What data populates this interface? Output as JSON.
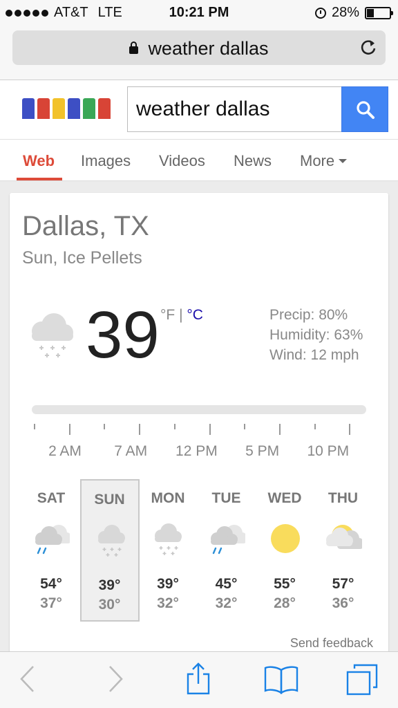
{
  "status_bar": {
    "carrier": "AT&T",
    "network": "LTE",
    "time": "10:21 PM",
    "battery_percent": "28%",
    "battery_level": 0.28,
    "signal_bars": 5
  },
  "browser": {
    "url_text": "weather dallas"
  },
  "search": {
    "query": "weather dallas",
    "logo_colors": [
      "#3d4fc4",
      "#d84436",
      "#f2c22a",
      "#3d4fc4",
      "#3aa757",
      "#d84436"
    ]
  },
  "tabs": [
    {
      "label": "Web",
      "active": true
    },
    {
      "label": "Images",
      "active": false
    },
    {
      "label": "Videos",
      "active": false
    },
    {
      "label": "News",
      "active": false
    },
    {
      "label": "More",
      "active": false
    }
  ],
  "weather": {
    "location": "Dallas, TX",
    "condition": "Sun, Ice Pellets",
    "temperature": "39",
    "unit_f": "°F",
    "unit_sep": " | ",
    "unit_c": "°C",
    "precip": "Precip: 80%",
    "humidity": "Humidity: 63%",
    "wind": "Wind: 12 mph",
    "hour_labels": [
      "2 AM",
      "7 AM",
      "12 PM",
      "5 PM",
      "10 PM"
    ],
    "days": [
      {
        "name": "SAT",
        "high": "54°",
        "low": "37°",
        "icon": "rain-partly-cloudy-icon",
        "selected": false
      },
      {
        "name": "SUN",
        "high": "39°",
        "low": "30°",
        "icon": "snow-cloud-icon",
        "selected": true
      },
      {
        "name": "MON",
        "high": "39°",
        "low": "32°",
        "icon": "snow-cloud-icon",
        "selected": false
      },
      {
        "name": "TUE",
        "high": "45°",
        "low": "32°",
        "icon": "rain-partly-cloudy-icon",
        "selected": false
      },
      {
        "name": "WED",
        "high": "55°",
        "low": "28°",
        "icon": "sun-icon",
        "selected": false
      },
      {
        "name": "THU",
        "high": "57°",
        "low": "36°",
        "icon": "partly-cloudy-icon",
        "selected": false
      }
    ],
    "feedback": "Send feedback"
  },
  "colors": {
    "accent_red": "#dd4b39",
    "search_blue": "#4285f4",
    "link_blue": "#1a0dab",
    "ios_blue": "#1a82e6",
    "sun_yellow": "#f9dc5c"
  }
}
